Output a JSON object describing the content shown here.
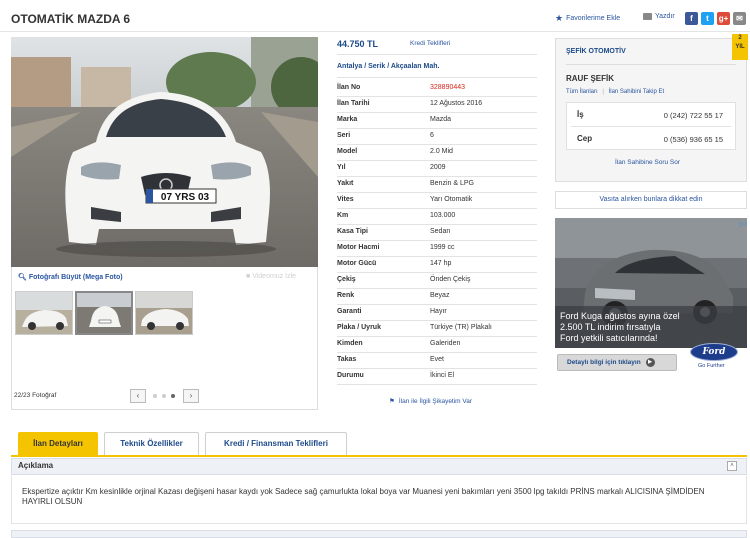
{
  "header": {
    "title": "OTOMATİK MAZDA 6",
    "favorite_label": "Favorilerime Ekle",
    "print_label": "Yazdır",
    "social": [
      {
        "icon": "facebook-icon",
        "glyph": "f",
        "color": "#3b5998"
      },
      {
        "icon": "twitter-icon",
        "glyph": "t",
        "color": "#1da1f2"
      },
      {
        "icon": "google-plus-icon",
        "glyph": "g+",
        "color": "#dd4b39"
      },
      {
        "icon": "email-icon",
        "glyph": "✉",
        "color": "#888888"
      }
    ]
  },
  "gallery": {
    "plate_text": "07 YRS 03",
    "zoom_label": "Fotoğrafı Büyüt (Mega Foto)",
    "video_label": "Videomuz İzle",
    "count_label": "22/23 Fotoğraf",
    "prev": "‹",
    "next": "›"
  },
  "listing": {
    "price": "44.750 TL",
    "credit_link": "Kredi Teklifleri",
    "location": "Antalya / Serik / Akçaalan Mah.",
    "rows": [
      {
        "label": "İlan No",
        "value": "328890443",
        "color": "#d9261c"
      },
      {
        "label": "İlan Tarihi",
        "value": "12 Ağustos 2016"
      },
      {
        "label": "Marka",
        "value": "Mazda"
      },
      {
        "label": "Seri",
        "value": "6"
      },
      {
        "label": "Model",
        "value": "2.0 Mid"
      },
      {
        "label": "Yıl",
        "value": "2009"
      },
      {
        "label": "Yakıt",
        "value": "Benzin & LPG"
      },
      {
        "label": "Vites",
        "value": "Yarı Otomatik"
      },
      {
        "label": "Km",
        "value": "103.000"
      },
      {
        "label": "Kasa Tipi",
        "value": "Sedan"
      },
      {
        "label": "Motor Hacmi",
        "value": "1999 cc"
      },
      {
        "label": "Motor Gücü",
        "value": "147 hp"
      },
      {
        "label": "Çekiş",
        "value": "Önden Çekiş"
      },
      {
        "label": "Renk",
        "value": "Beyaz"
      },
      {
        "label": "Garanti",
        "value": "Hayır"
      },
      {
        "label": "Plaka / Uyruk",
        "value": "Türkiye (TR) Plakalı"
      },
      {
        "label": "Kimden",
        "value": "Galeriden"
      },
      {
        "label": "Takas",
        "value": "Evet"
      },
      {
        "label": "Durumu",
        "value": "İkinci El"
      }
    ],
    "report_link": "İlan ile İlgili Şikayetim Var"
  },
  "seller": {
    "store": "ŞEFİK OTOMOTİV",
    "badge_line1": "2",
    "badge_line2": "YIL",
    "name": "RAUF ŞEFİK",
    "all_listings": "Tüm İlanları",
    "follow": "İlan Sahibini Takip Et",
    "phones": [
      {
        "label": "İş",
        "number": "0 (242) 722 55 17"
      },
      {
        "label": "Cep",
        "number": "0 (536) 936 65 15"
      }
    ],
    "ask_link": "İlan Sahibine Soru Sor",
    "warning": "Vasıta alırken bunlara dikkat edin"
  },
  "ad": {
    "text_line1": "Ford Kuga ağustos ayına özel",
    "text_line2": "2.500 TL indirim fırsatıyla",
    "text_line3": "Ford yetkili satıcılarında!",
    "button": "Detaylı bilgi için tıklayın",
    "brand": "Ford",
    "slogan": "Go Further"
  },
  "tabs": [
    "İlan Detayları",
    "Teknik Özellikler",
    "Kredi / Finansman Teklifleri"
  ],
  "description": {
    "title": "Açıklama",
    "toggle": "˄",
    "text": "Ekspertize açıktır Km kesinlikle orjinal Kazası değişeni hasar kaydı yok Sadece sağ çamurlukta lokal boya var Muanesi yeni bakımları yeni 3500 lpg takıldı PRİNS markalı ALICISINA ŞİMDİDEN HAYIRLI OLSUN"
  },
  "colors": {
    "accent": "#f5c400",
    "link": "#2a55a0",
    "brand_blue": "#1c4a8a",
    "listing_no": "#d9261c"
  }
}
